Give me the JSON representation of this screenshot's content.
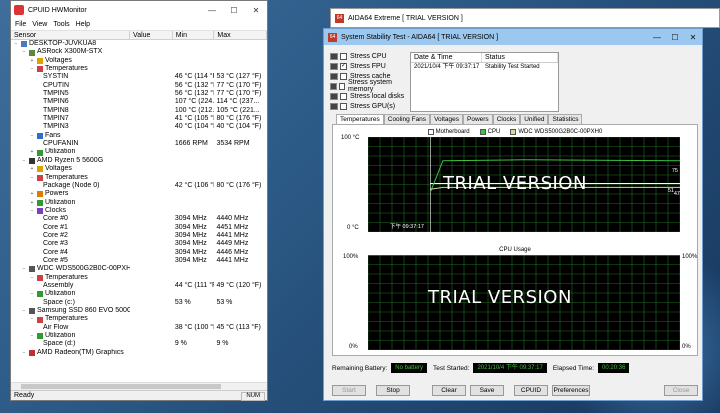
{
  "hwmonitor": {
    "title": "CPUID HWMonitor",
    "menu": [
      "File",
      "View",
      "Tools",
      "Help"
    ],
    "columns": [
      "Sensor",
      "Value",
      "Min",
      "Max"
    ],
    "rows": [
      {
        "d": 0,
        "exp": "−",
        "icon": "computer",
        "name": "DESKTOP-JUVKUA8",
        "v": "",
        "min": "",
        "max": ""
      },
      {
        "d": 1,
        "exp": "−",
        "icon": "board",
        "name": "ASRock X300M-STX",
        "v": "",
        "min": "",
        "max": ""
      },
      {
        "d": 2,
        "exp": "+",
        "icon": "volt",
        "name": "Voltages",
        "v": "",
        "min": "",
        "max": ""
      },
      {
        "d": 2,
        "exp": "−",
        "icon": "temp",
        "name": "Temperatures",
        "v": "",
        "min": "",
        "max": ""
      },
      {
        "d": 3,
        "exp": "",
        "icon": "",
        "name": "SYSTIN",
        "v": "51 °C (123 °F)",
        "min": "46 °C (114 °F)",
        "max": "53 °C (127 °F)"
      },
      {
        "d": 3,
        "exp": "",
        "icon": "",
        "name": "CPUTIN",
        "v": "76 °C (167 °F)",
        "min": "56 °C (132 °F)",
        "max": "77 °C (170 °F)"
      },
      {
        "d": 3,
        "exp": "",
        "icon": "",
        "name": "TMPIN5",
        "v": "75 °C (167 °F)",
        "min": "56 °C (132 °F)",
        "max": "77 °C (170 °F)"
      },
      {
        "d": 3,
        "exp": "",
        "icon": "",
        "name": "TMPIN6",
        "v": "109 °C (228...",
        "min": "107 °C (224...",
        "max": "114 °C (237..."
      },
      {
        "d": 3,
        "exp": "",
        "icon": "",
        "name": "TMPIN8",
        "v": "102 °C (215...",
        "min": "100 °C (212...",
        "max": "105 °C (221..."
      },
      {
        "d": 3,
        "exp": "",
        "icon": "",
        "name": "TMPIN7",
        "v": "79 °C (174 °F)",
        "min": "41 °C (105 °F)",
        "max": "80 °C (176 °F)"
      },
      {
        "d": 3,
        "exp": "",
        "icon": "",
        "name": "TMPIN3",
        "v": "40 °C (104 °F)",
        "min": "40 °C (104 °F)",
        "max": "40 °C (104 °F)"
      },
      {
        "d": 2,
        "exp": "−",
        "icon": "fan",
        "name": "Fans",
        "v": "",
        "min": "",
        "max": ""
      },
      {
        "d": 3,
        "exp": "",
        "icon": "",
        "name": "CPUFANIN",
        "v": "2934 RPM",
        "min": "1666 RPM",
        "max": "3534 RPM"
      },
      {
        "d": 2,
        "exp": "+",
        "icon": "util",
        "name": "Utilization",
        "v": "",
        "min": "",
        "max": ""
      },
      {
        "d": 1,
        "exp": "−",
        "icon": "cpu",
        "name": "AMD Ryzen 5 5600G",
        "v": "",
        "min": "",
        "max": ""
      },
      {
        "d": 2,
        "exp": "+",
        "icon": "volt",
        "name": "Voltages",
        "v": "",
        "min": "",
        "max": ""
      },
      {
        "d": 2,
        "exp": "−",
        "icon": "temp",
        "name": "Temperatures",
        "v": "",
        "min": "",
        "max": ""
      },
      {
        "d": 3,
        "exp": "",
        "icon": "",
        "name": "Package (Node 0)",
        "v": "80 °C (175 °F)",
        "min": "42 °C (106 °F)",
        "max": "80 °C (176 °F)"
      },
      {
        "d": 2,
        "exp": "+",
        "icon": "power",
        "name": "Powers",
        "v": "",
        "min": "",
        "max": ""
      },
      {
        "d": 2,
        "exp": "+",
        "icon": "util",
        "name": "Utilization",
        "v": "",
        "min": "",
        "max": ""
      },
      {
        "d": 2,
        "exp": "−",
        "icon": "clock",
        "name": "Clocks",
        "v": "",
        "min": "",
        "max": ""
      },
      {
        "d": 3,
        "exp": "",
        "icon": "",
        "name": "Core #0",
        "v": "4291 MHz",
        "min": "3094 MHz",
        "max": "4440 MHz"
      },
      {
        "d": 3,
        "exp": "",
        "icon": "",
        "name": "Core #1",
        "v": "4291 MHz",
        "min": "3094 MHz",
        "max": "4451 MHz"
      },
      {
        "d": 3,
        "exp": "",
        "icon": "",
        "name": "Core #2",
        "v": "4291 MHz",
        "min": "3094 MHz",
        "max": "4441 MHz"
      },
      {
        "d": 3,
        "exp": "",
        "icon": "",
        "name": "Core #3",
        "v": "4291 MHz",
        "min": "3094 MHz",
        "max": "4449 MHz"
      },
      {
        "d": 3,
        "exp": "",
        "icon": "",
        "name": "Core #4",
        "v": "4291 MHz",
        "min": "3094 MHz",
        "max": "4446 MHz"
      },
      {
        "d": 3,
        "exp": "",
        "icon": "",
        "name": "Core #5",
        "v": "4291 MHz",
        "min": "3094 MHz",
        "max": "4441 MHz"
      },
      {
        "d": 1,
        "exp": "−",
        "icon": "disk",
        "name": "WDC WDS500G2B0C-00PXH0",
        "v": "",
        "min": "",
        "max": ""
      },
      {
        "d": 2,
        "exp": "−",
        "icon": "temp",
        "name": "Temperatures",
        "v": "",
        "min": "",
        "max": ""
      },
      {
        "d": 3,
        "exp": "",
        "icon": "",
        "name": "Assembly",
        "v": "47 °C (116 °F)",
        "min": "44 °C (111 °F)",
        "max": "49 °C (120 °F)"
      },
      {
        "d": 2,
        "exp": "−",
        "icon": "util",
        "name": "Utilization",
        "v": "",
        "min": "",
        "max": ""
      },
      {
        "d": 3,
        "exp": "",
        "icon": "",
        "name": "Space (c:)",
        "v": "53 %",
        "min": "53 %",
        "max": "53 %"
      },
      {
        "d": 1,
        "exp": "−",
        "icon": "disk",
        "name": "Samsung SSD 860 EVO 500GB",
        "v": "",
        "min": "",
        "max": ""
      },
      {
        "d": 2,
        "exp": "−",
        "icon": "temp",
        "name": "Temperatures",
        "v": "",
        "min": "",
        "max": ""
      },
      {
        "d": 3,
        "exp": "",
        "icon": "",
        "name": "Air Flow",
        "v": "43 °C (109 °F)",
        "min": "38 °C (100 °F)",
        "max": "45 °C (113 °F)"
      },
      {
        "d": 2,
        "exp": "−",
        "icon": "util",
        "name": "Utilization",
        "v": "",
        "min": "",
        "max": ""
      },
      {
        "d": 3,
        "exp": "",
        "icon": "",
        "name": "Space (d:)",
        "v": "9 %",
        "min": "9 %",
        "max": "9 %"
      },
      {
        "d": 1,
        "exp": "−",
        "icon": "gpu",
        "name": "AMD Radeon(TM) Graphics",
        "v": "",
        "min": "",
        "max": ""
      }
    ],
    "status": "Ready",
    "num": "NUM"
  },
  "aida_main": {
    "title": "AIDA64 Extreme  [ TRIAL VERSION ]"
  },
  "stability": {
    "title": "System Stability Test - AIDA64  [ TRIAL VERSION ]",
    "options": [
      {
        "label": "Stress CPU",
        "checked": false
      },
      {
        "label": "Stress FPU",
        "checked": true
      },
      {
        "label": "Stress cache",
        "checked": false
      },
      {
        "label": "Stress system memory",
        "checked": false
      },
      {
        "label": "Stress local disks",
        "checked": false
      },
      {
        "label": "Stress GPU(s)",
        "checked": false
      }
    ],
    "log_headers": [
      "Date & Time",
      "Status"
    ],
    "log": [
      {
        "time": "2021/10/4 下午 09:37:17",
        "status": "Stability Test Started"
      }
    ],
    "tabs": [
      "Temperatures",
      "Cooling Fans",
      "Voltages",
      "Powers",
      "Clocks",
      "Unified",
      "Statistics"
    ],
    "legend": [
      {
        "label": "Motherboard",
        "color": "#ffffff"
      },
      {
        "label": "CPU",
        "color": "#3ec13e"
      },
      {
        "label": "WDC WDS500G2B0C-00PXH0",
        "color": "#d8d8a0"
      }
    ],
    "temp_chart": {
      "ymax": "100 °C",
      "ymin": "0 °C",
      "time": "下午 09:37:17",
      "watermark": "TRIAL VERSION",
      "val_a": "75",
      "val_b": "51",
      "val_c": "47"
    },
    "cpu_chart": {
      "title": "CPU Usage",
      "ymax": "100%",
      "ymin": "0%",
      "watermark": "TRIAL VERSION",
      "val_top": "100%",
      "val_bot": "0%"
    },
    "info": {
      "battery_label": "Remaining Battery:",
      "battery": "No battery",
      "started_label": "Test Started:",
      "started": "2021/10/4 下午 09:37:17",
      "elapsed_label": "Elapsed Time:",
      "elapsed": "00:20:36"
    },
    "buttons": {
      "start": "Start",
      "stop": "Stop",
      "clear": "Clear",
      "save": "Save",
      "cpuid": "CPUID",
      "prefs": "Preferences",
      "close": "Close"
    }
  },
  "chart_data": [
    {
      "type": "line",
      "title": "",
      "ylabel": "",
      "ylim": [
        0,
        100
      ],
      "series": [
        {
          "name": "Motherboard",
          "values": [
            51,
            51,
            51,
            51
          ]
        },
        {
          "name": "CPU",
          "values": [
            42,
            75,
            76,
            75
          ]
        },
        {
          "name": "WDC WDS500G2B0C-00PXH0",
          "values": [
            45,
            47,
            47,
            47
          ]
        }
      ]
    },
    {
      "type": "line",
      "title": "CPU Usage",
      "ylim": [
        0,
        100
      ],
      "series": [
        {
          "name": "",
          "values": [
            100,
            100,
            100,
            100
          ]
        }
      ]
    }
  ]
}
